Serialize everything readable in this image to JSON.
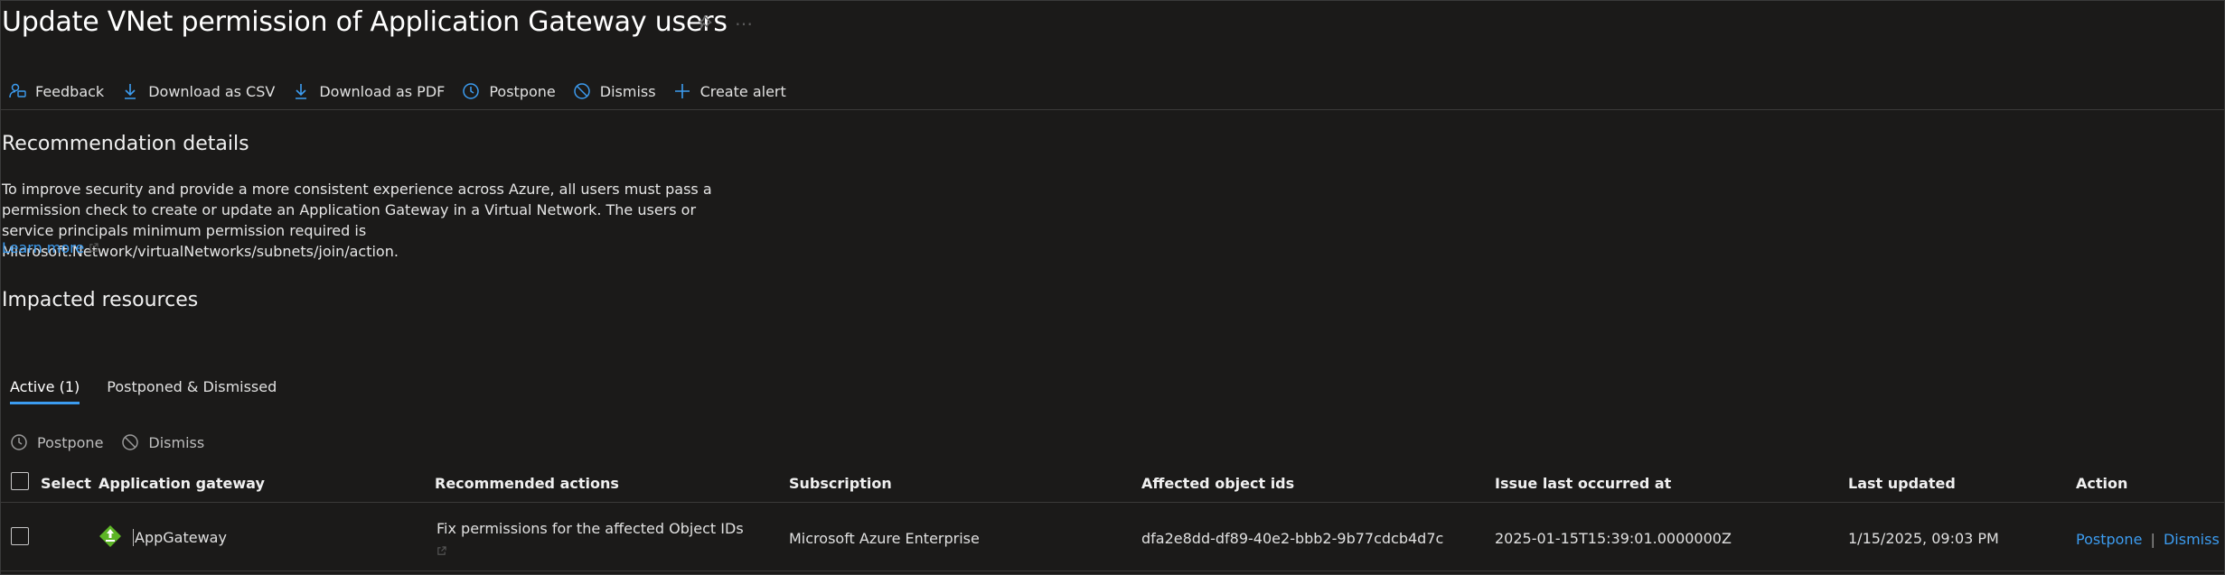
{
  "page": {
    "title": "Update VNet permission of Application Gateway users",
    "more": "…"
  },
  "toolbar": {
    "feedback": "Feedback",
    "download_csv": "Download as CSV",
    "download_pdf": "Download as PDF",
    "postpone": "Postpone",
    "dismiss": "Dismiss",
    "create_alert": "Create alert"
  },
  "details": {
    "heading": "Recommendation details",
    "description": "To improve security and provide a more consistent experience across Azure, all users must pass a permission check to create or update an Application Gateway in a Virtual Network. The users or service principals minimum permission required is Microsoft.Network/virtualNetworks/subnets/join/action.",
    "learn_more": "Learn more"
  },
  "impacted": {
    "heading": "Impacted resources",
    "tabs": [
      {
        "label": "Active (1)",
        "active": true
      },
      {
        "label": "Postponed & Dismissed",
        "active": false
      }
    ],
    "actions": {
      "postpone": "Postpone",
      "dismiss": "Dismiss"
    },
    "table": {
      "headers": {
        "select": "Select",
        "gateway": "Application gateway",
        "recommended": "Recommended actions",
        "subscription": "Subscription",
        "object_ids": "Affected object ids",
        "last_occurred": "Issue last occurred at",
        "last_updated": "Last updated",
        "action": "Action"
      },
      "rows": [
        {
          "gateway": "AppGateway",
          "recommended": "Fix permissions for the affected Object IDs",
          "subscription": "Microsoft Azure Enterprise",
          "object_ids": "dfa2e8dd-df89-40e2-bbb2-9b77cdcb4d7c",
          "last_occurred": "2025-01-15T15:39:01.0000000Z",
          "last_updated": "1/15/2025, 09:03 PM",
          "action_postpone": "Postpone",
          "action_sep": "|",
          "action_dismiss": "Dismiss"
        }
      ]
    }
  },
  "colors": {
    "background": "#1b1a19",
    "accent": "#3c9cf0",
    "gateway_icon": "#5db526"
  },
  "icons": [
    "pin-icon",
    "feedback-icon",
    "download-icon",
    "clock-icon",
    "dismiss-icon",
    "plus-icon",
    "external-link-icon",
    "app-gateway-icon"
  ]
}
